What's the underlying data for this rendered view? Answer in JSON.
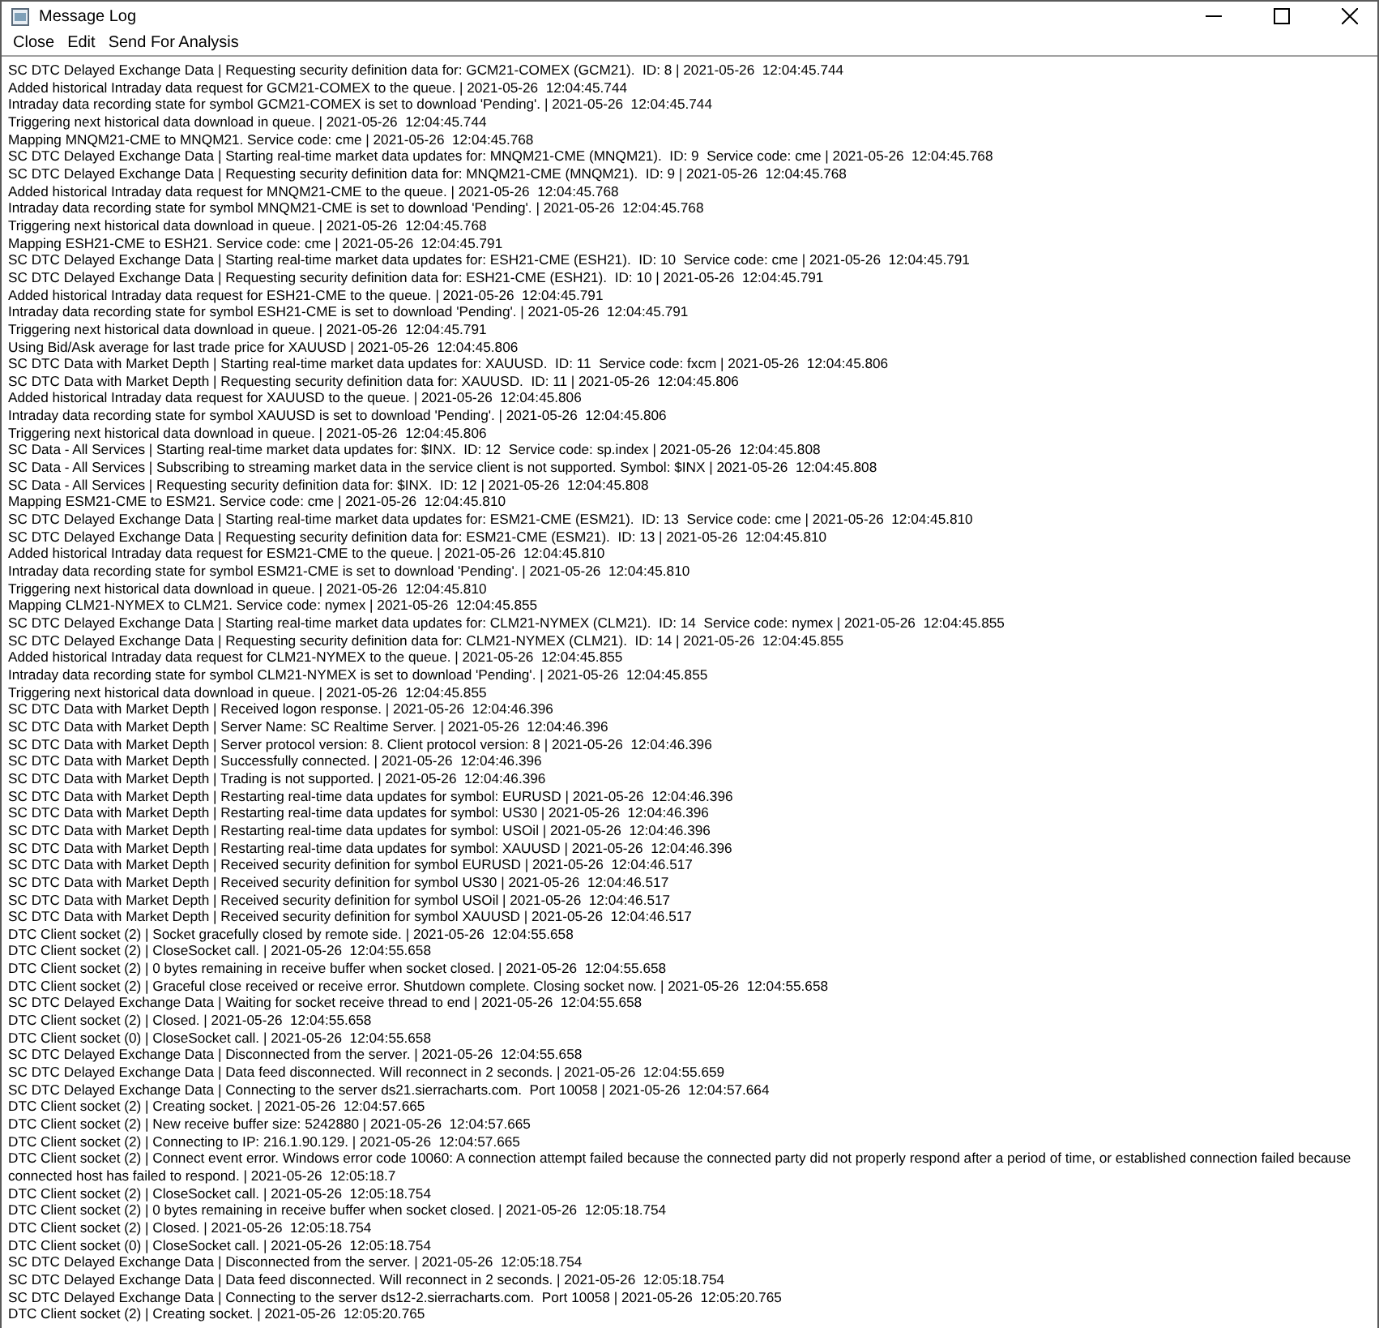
{
  "window": {
    "title": "Message Log"
  },
  "menu": [
    {
      "label": "Close"
    },
    {
      "label": "Edit"
    },
    {
      "label": "Send For Analysis"
    }
  ],
  "log_lines": [
    "SC DTC Delayed Exchange Data | Requesting security definition data for: GCM21-COMEX (GCM21).  ID: 8 | 2021-05-26  12:04:45.744",
    "Added historical Intraday data request for GCM21-COMEX to the queue. | 2021-05-26  12:04:45.744",
    "Intraday data recording state for symbol GCM21-COMEX is set to download 'Pending'. | 2021-05-26  12:04:45.744",
    "Triggering next historical data download in queue. | 2021-05-26  12:04:45.744",
    "Mapping MNQM21-CME to MNQM21. Service code: cme | 2021-05-26  12:04:45.768",
    "SC DTC Delayed Exchange Data | Starting real-time market data updates for: MNQM21-CME (MNQM21).  ID: 9  Service code: cme | 2021-05-26  12:04:45.768",
    "SC DTC Delayed Exchange Data | Requesting security definition data for: MNQM21-CME (MNQM21).  ID: 9 | 2021-05-26  12:04:45.768",
    "Added historical Intraday data request for MNQM21-CME to the queue. | 2021-05-26  12:04:45.768",
    "Intraday data recording state for symbol MNQM21-CME is set to download 'Pending'. | 2021-05-26  12:04:45.768",
    "Triggering next historical data download in queue. | 2021-05-26  12:04:45.768",
    "Mapping ESH21-CME to ESH21. Service code: cme | 2021-05-26  12:04:45.791",
    "SC DTC Delayed Exchange Data | Starting real-time market data updates for: ESH21-CME (ESH21).  ID: 10  Service code: cme | 2021-05-26  12:04:45.791",
    "SC DTC Delayed Exchange Data | Requesting security definition data for: ESH21-CME (ESH21).  ID: 10 | 2021-05-26  12:04:45.791",
    "Added historical Intraday data request for ESH21-CME to the queue. | 2021-05-26  12:04:45.791",
    "Intraday data recording state for symbol ESH21-CME is set to download 'Pending'. | 2021-05-26  12:04:45.791",
    "Triggering next historical data download in queue. | 2021-05-26  12:04:45.791",
    "Using Bid/Ask average for last trade price for XAUUSD | 2021-05-26  12:04:45.806",
    "SC DTC Data with Market Depth | Starting real-time market data updates for: XAUUSD.  ID: 11  Service code: fxcm | 2021-05-26  12:04:45.806",
    "SC DTC Data with Market Depth | Requesting security definition data for: XAUUSD.  ID: 11 | 2021-05-26  12:04:45.806",
    "Added historical Intraday data request for XAUUSD to the queue. | 2021-05-26  12:04:45.806",
    "Intraday data recording state for symbol XAUUSD is set to download 'Pending'. | 2021-05-26  12:04:45.806",
    "Triggering next historical data download in queue. | 2021-05-26  12:04:45.806",
    "SC Data - All Services | Starting real-time market data updates for: $INX.  ID: 12  Service code: sp.index | 2021-05-26  12:04:45.808",
    "SC Data - All Services | Subscribing to streaming market data in the service client is not supported. Symbol: $INX | 2021-05-26  12:04:45.808",
    "SC Data - All Services | Requesting security definition data for: $INX.  ID: 12 | 2021-05-26  12:04:45.808",
    "Mapping ESM21-CME to ESM21. Service code: cme | 2021-05-26  12:04:45.810",
    "SC DTC Delayed Exchange Data | Starting real-time market data updates for: ESM21-CME (ESM21).  ID: 13  Service code: cme | 2021-05-26  12:04:45.810",
    "SC DTC Delayed Exchange Data | Requesting security definition data for: ESM21-CME (ESM21).  ID: 13 | 2021-05-26  12:04:45.810",
    "Added historical Intraday data request for ESM21-CME to the queue. | 2021-05-26  12:04:45.810",
    "Intraday data recording state for symbol ESM21-CME is set to download 'Pending'. | 2021-05-26  12:04:45.810",
    "Triggering next historical data download in queue. | 2021-05-26  12:04:45.810",
    "Mapping CLM21-NYMEX to CLM21. Service code: nymex | 2021-05-26  12:04:45.855",
    "SC DTC Delayed Exchange Data | Starting real-time market data updates for: CLM21-NYMEX (CLM21).  ID: 14  Service code: nymex | 2021-05-26  12:04:45.855",
    "SC DTC Delayed Exchange Data | Requesting security definition data for: CLM21-NYMEX (CLM21).  ID: 14 | 2021-05-26  12:04:45.855",
    "Added historical Intraday data request for CLM21-NYMEX to the queue. | 2021-05-26  12:04:45.855",
    "Intraday data recording state for symbol CLM21-NYMEX is set to download 'Pending'. | 2021-05-26  12:04:45.855",
    "Triggering next historical data download in queue. | 2021-05-26  12:04:45.855",
    "SC DTC Data with Market Depth | Received logon response. | 2021-05-26  12:04:46.396",
    "SC DTC Data with Market Depth | Server Name: SC Realtime Server. | 2021-05-26  12:04:46.396",
    "SC DTC Data with Market Depth | Server protocol version: 8. Client protocol version: 8 | 2021-05-26  12:04:46.396",
    "SC DTC Data with Market Depth | Successfully connected. | 2021-05-26  12:04:46.396",
    "SC DTC Data with Market Depth | Trading is not supported. | 2021-05-26  12:04:46.396",
    "SC DTC Data with Market Depth | Restarting real-time data updates for symbol: EURUSD | 2021-05-26  12:04:46.396",
    "SC DTC Data with Market Depth | Restarting real-time data updates for symbol: US30 | 2021-05-26  12:04:46.396",
    "SC DTC Data with Market Depth | Restarting real-time data updates for symbol: USOil | 2021-05-26  12:04:46.396",
    "SC DTC Data with Market Depth | Restarting real-time data updates for symbol: XAUUSD | 2021-05-26  12:04:46.396",
    "SC DTC Data with Market Depth | Received security definition for symbol EURUSD | 2021-05-26  12:04:46.517",
    "SC DTC Data with Market Depth | Received security definition for symbol US30 | 2021-05-26  12:04:46.517",
    "SC DTC Data with Market Depth | Received security definition for symbol USOil | 2021-05-26  12:04:46.517",
    "SC DTC Data with Market Depth | Received security definition for symbol XAUUSD | 2021-05-26  12:04:46.517",
    "DTC Client socket (2) | Socket gracefully closed by remote side. | 2021-05-26  12:04:55.658",
    "DTC Client socket (2) | CloseSocket call. | 2021-05-26  12:04:55.658",
    "DTC Client socket (2) | 0 bytes remaining in receive buffer when socket closed. | 2021-05-26  12:04:55.658",
    "DTC Client socket (2) | Graceful close received or receive error. Shutdown complete. Closing socket now. | 2021-05-26  12:04:55.658",
    "SC DTC Delayed Exchange Data | Waiting for socket receive thread to end | 2021-05-26  12:04:55.658",
    "DTC Client socket (2) | Closed. | 2021-05-26  12:04:55.658",
    "DTC Client socket (0) | CloseSocket call. | 2021-05-26  12:04:55.658",
    "SC DTC Delayed Exchange Data | Disconnected from the server. | 2021-05-26  12:04:55.658",
    "SC DTC Delayed Exchange Data | Data feed disconnected. Will reconnect in 2 seconds. | 2021-05-26  12:04:55.659",
    "SC DTC Delayed Exchange Data | Connecting to the server ds21.sierracharts.com.  Port 10058 | 2021-05-26  12:04:57.664",
    "DTC Client socket (2) | Creating socket. | 2021-05-26  12:04:57.665",
    "DTC Client socket (2) | New receive buffer size: 5242880 | 2021-05-26  12:04:57.665",
    "DTC Client socket (2) | Connecting to IP: 216.1.90.129. | 2021-05-26  12:04:57.665",
    "DTC Client socket (2) | Connect event error. Windows error code 10060: A connection attempt failed because the connected party did not properly respond after a period of time, or established connection failed because connected host has failed to respond. | 2021-05-26  12:05:18.7",
    "DTC Client socket (2) | CloseSocket call. | 2021-05-26  12:05:18.754",
    "DTC Client socket (2) | 0 bytes remaining in receive buffer when socket closed. | 2021-05-26  12:05:18.754",
    "DTC Client socket (2) | Closed. | 2021-05-26  12:05:18.754",
    "DTC Client socket (0) | CloseSocket call. | 2021-05-26  12:05:18.754",
    "SC DTC Delayed Exchange Data | Disconnected from the server. | 2021-05-26  12:05:18.754",
    "SC DTC Delayed Exchange Data | Data feed disconnected. Will reconnect in 2 seconds. | 2021-05-26  12:05:18.754",
    "SC DTC Delayed Exchange Data | Connecting to the server ds12-2.sierracharts.com.  Port 10058 | 2021-05-26  12:05:20.765",
    "DTC Client socket (2) | Creating socket. | 2021-05-26  12:05:20.765"
  ]
}
